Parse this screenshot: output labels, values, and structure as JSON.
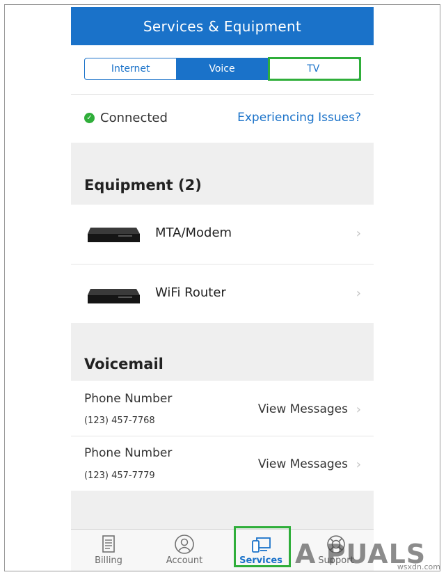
{
  "header": {
    "title": "Services & Equipment"
  },
  "tabs": [
    {
      "label": "Internet",
      "active": false
    },
    {
      "label": "Voice",
      "active": true
    },
    {
      "label": "TV",
      "active": false
    }
  ],
  "status": {
    "text": "Connected",
    "link": "Experiencing Issues?"
  },
  "equipment": {
    "title": "Equipment (2)",
    "items": [
      {
        "label": "MTA/Modem",
        "icon": "modem-device-icon"
      },
      {
        "label": "WiFi Router",
        "icon": "router-device-icon"
      }
    ]
  },
  "voicemail": {
    "title": "Voicemail",
    "items": [
      {
        "label": "Phone Number",
        "number": "(123) 457-7768",
        "action": "View Messages"
      },
      {
        "label": "Phone Number",
        "number": "(123) 457-7779",
        "action": "View Messages"
      }
    ]
  },
  "tabbar": [
    {
      "label": "Billing",
      "icon": "receipt-icon",
      "active": false
    },
    {
      "label": "Account",
      "icon": "person-icon",
      "active": false
    },
    {
      "label": "Services",
      "icon": "devices-icon",
      "active": true
    },
    {
      "label": "Support",
      "icon": "lifebuoy-icon",
      "active": false
    }
  ],
  "watermark": {
    "brand": "A PUALS",
    "site": "wsxdn.com"
  },
  "colors": {
    "brand_blue": "#1a72c9",
    "highlight_green": "#2fae3a",
    "section_gray": "#efefef"
  }
}
